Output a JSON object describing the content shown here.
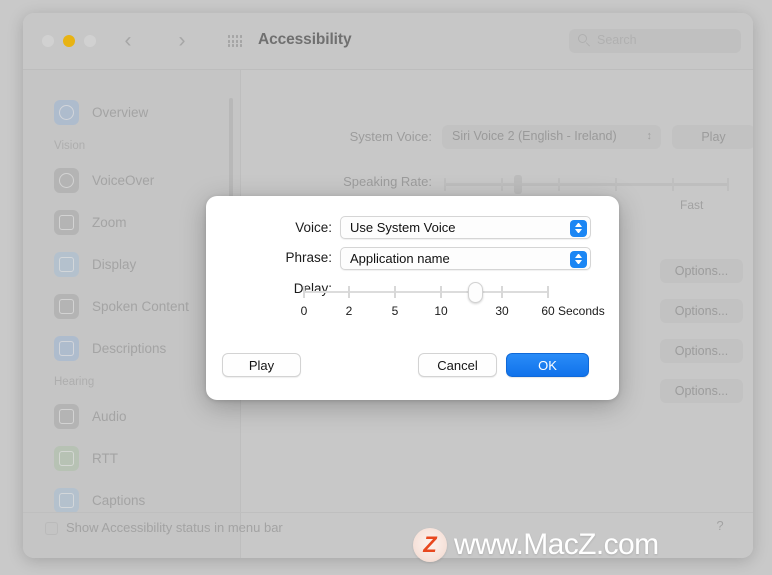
{
  "window": {
    "title": "Accessibility",
    "traffic_lights": [
      {
        "name": "close",
        "color": "#d9d9d9"
      },
      {
        "name": "minimize",
        "color": "#f2b705"
      },
      {
        "name": "zoom",
        "color": "#d9d9d9"
      }
    ],
    "nav_back": "‹",
    "nav_forward": "›",
    "grid_icon": "grid-icon"
  },
  "search": {
    "placeholder": "Search",
    "icon": "search-icon"
  },
  "sidebar": {
    "items": [
      {
        "type": "item",
        "label": "Overview",
        "icon": "overview-icon",
        "icon_color": "#9fb9dd"
      },
      {
        "type": "header",
        "label": "Vision"
      },
      {
        "type": "item",
        "label": "VoiceOver",
        "icon": "voiceover-icon",
        "icon_color": "#a9a9a9"
      },
      {
        "type": "item",
        "label": "Zoom",
        "icon": "zoom-icon",
        "icon_color": "#a9a9a9"
      },
      {
        "type": "item",
        "label": "Display",
        "icon": "display-icon",
        "icon_color": "#a9c4dd"
      },
      {
        "type": "item",
        "label": "Spoken Content",
        "icon": "spoken-content-icon",
        "icon_color": "#a9a9a9"
      },
      {
        "type": "item",
        "label": "Descriptions",
        "icon": "descriptions-icon",
        "icon_color": "#9fb9dd"
      },
      {
        "type": "header",
        "label": "Hearing"
      },
      {
        "type": "item",
        "label": "Audio",
        "icon": "audio-icon",
        "icon_color": "#a9a9a9"
      },
      {
        "type": "item",
        "label": "RTT",
        "icon": "rtt-icon",
        "icon_color": "#aec6a9"
      },
      {
        "type": "item",
        "label": "Captions",
        "icon": "captions-icon",
        "icon_color": "#a9c4dd"
      }
    ]
  },
  "content": {
    "system_voice_label": "System Voice:",
    "system_voice_value": "Siri Voice 2 (English - Ireland)",
    "play_button": "Play",
    "speaking_rate_label": "Speaking Rate:",
    "speaking_rate_fast": "Fast",
    "options_buttons": [
      "Options...",
      "Options...",
      "Options...",
      "Options..."
    ]
  },
  "bottom": {
    "checkbox_label": "Show Accessibility status in menu bar",
    "checkbox_checked": false,
    "help_label": "?"
  },
  "sheet": {
    "voice_label": "Voice:",
    "voice_value": "Use System Voice",
    "phrase_label": "Phrase:",
    "phrase_value": "Application name",
    "delay_label": "Delay:",
    "delay_unit": "Seconds",
    "delay_ticks": [
      "0",
      "2",
      "5",
      "10",
      "30",
      "60"
    ],
    "delay_selected": "20",
    "play_button": "Play",
    "cancel_button": "Cancel",
    "ok_button": "OK",
    "accent_color": "#1b86f4"
  },
  "watermark": {
    "logo_letter": "Z",
    "text": "www.MacZ.com",
    "logo_color": "#e8481f"
  }
}
